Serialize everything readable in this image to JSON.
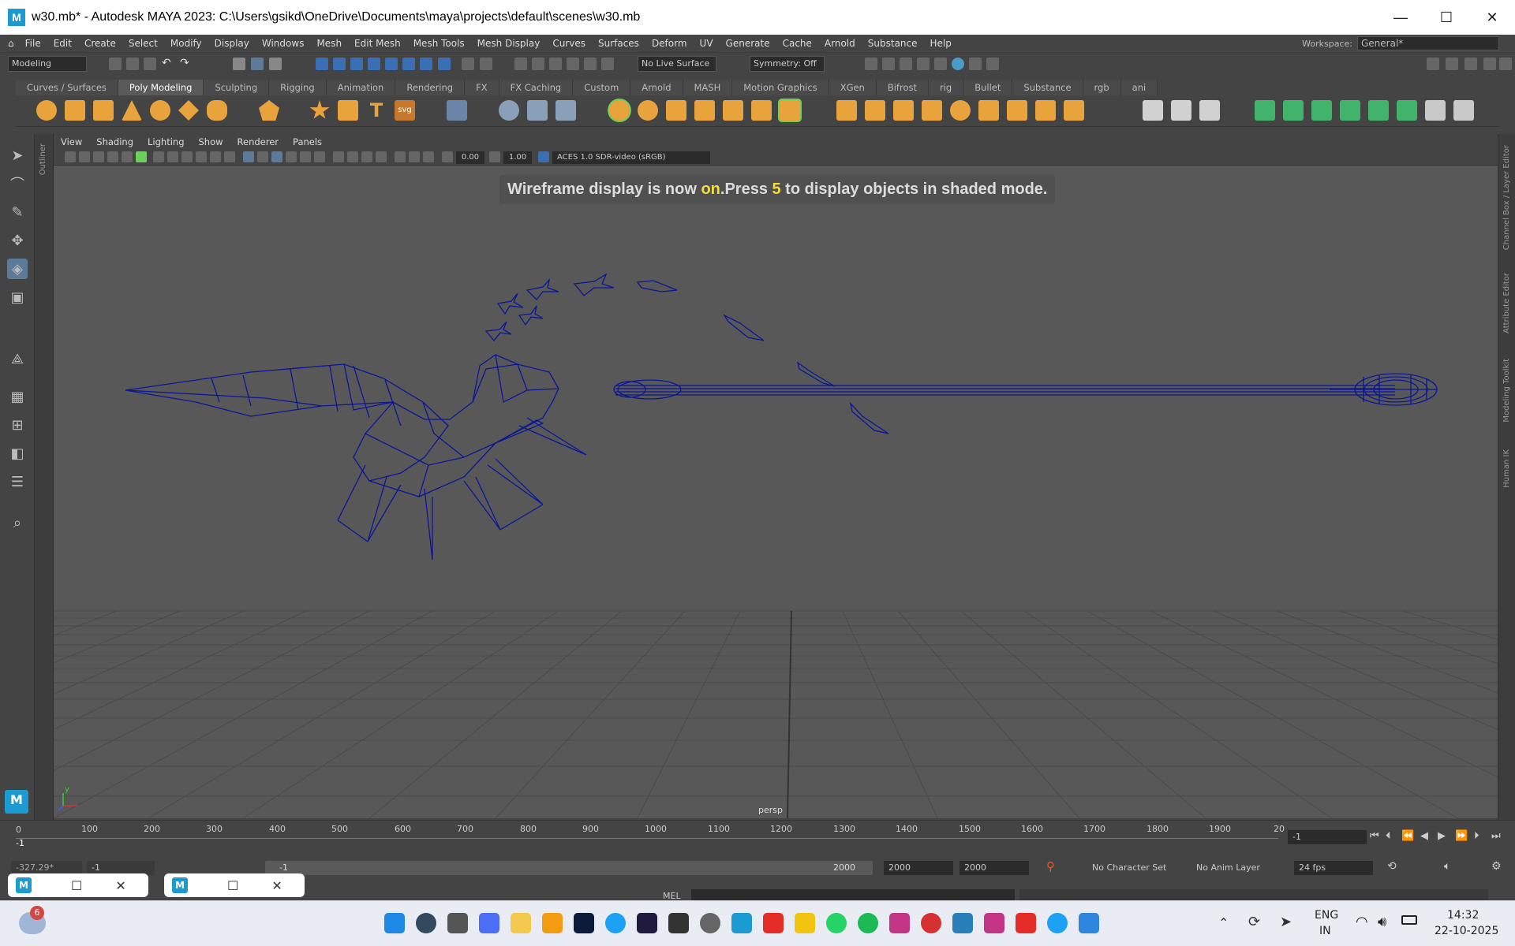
{
  "window": {
    "title": "w30.mb* - Autodesk MAYA 2023: C:\\Users\\gsikd\\OneDrive\\Documents\\maya\\projects\\default\\scenes\\w30.mb",
    "app_icon": "M",
    "minimize_glyph": "—",
    "maximize_glyph": "☐",
    "close_glyph": "✕"
  },
  "menubar": {
    "items": [
      "File",
      "Edit",
      "Create",
      "Select",
      "Modify",
      "Display",
      "Windows",
      "Mesh",
      "Edit Mesh",
      "Mesh Tools",
      "Mesh Display",
      "Curves",
      "Surfaces",
      "Deform",
      "UV",
      "Generate",
      "Cache",
      "Arnold",
      "Substance",
      "Help"
    ],
    "workspace_label": "Workspace:",
    "workspace_value": "General*"
  },
  "statusline": {
    "mode": "Modeling",
    "live_surface": "No Live Surface",
    "symmetry": "Symmetry: Off"
  },
  "shelf": {
    "tabs": [
      "Curves / Surfaces",
      "Poly Modeling",
      "Sculpting",
      "Rigging",
      "Animation",
      "Rendering",
      "FX",
      "FX Caching",
      "Custom",
      "Arnold",
      "MASH",
      "Motion Graphics",
      "XGen",
      "Bifrost",
      "rig",
      "Bullet",
      "Substance",
      "rgb",
      "ani"
    ],
    "active_tab": "Poly Modeling",
    "svg_label": "svg",
    "text_glyph": "T"
  },
  "panel": {
    "menus": [
      "View",
      "Shading",
      "Lighting",
      "Show",
      "Renderer",
      "Panels"
    ],
    "exposure": "0.00",
    "gamma": "1.00",
    "color_space": "ACES 1.0 SDR-video (sRGB)",
    "outliner_label": "Outliner"
  },
  "viewport": {
    "hud_part1": "Wireframe display is now ",
    "hud_on": "on",
    "hud_part2": ".Press ",
    "hud_key": "5",
    "hud_part3": " to display objects in shaded mode.",
    "camera": "persp",
    "axis_y": "y",
    "wire_color": "#0b1696"
  },
  "right_tabs": [
    "Channel Box / Layer Editor",
    "Attribute Editor",
    "Modeling Toolkit",
    "Human IK"
  ],
  "timeline": {
    "ticks": [
      "100",
      "200",
      "300",
      "400",
      "500",
      "600",
      "700",
      "800",
      "900",
      "1000",
      "1100",
      "1200",
      "1300",
      "1400",
      "1500",
      "1600",
      "1700",
      "1800",
      "1900",
      "20"
    ],
    "current_frame": "-1",
    "current_frame_field": "-1",
    "start_marker": "0"
  },
  "range": {
    "coord": "-327.29*",
    "start": "-1",
    "range_start": "-1",
    "range_end": "2000",
    "end": "2000",
    "end2": "2000",
    "character_set": "No Character Set",
    "anim_layer": "No Anim Layer",
    "fps": "24 fps"
  },
  "cmdline": {
    "label": "MEL"
  },
  "taskbar": {
    "weather_badge": "6",
    "lang1": "ENG",
    "lang2": "IN",
    "time": "14:32",
    "date": "22-10-2025"
  },
  "thumbs": {
    "app": "M"
  }
}
